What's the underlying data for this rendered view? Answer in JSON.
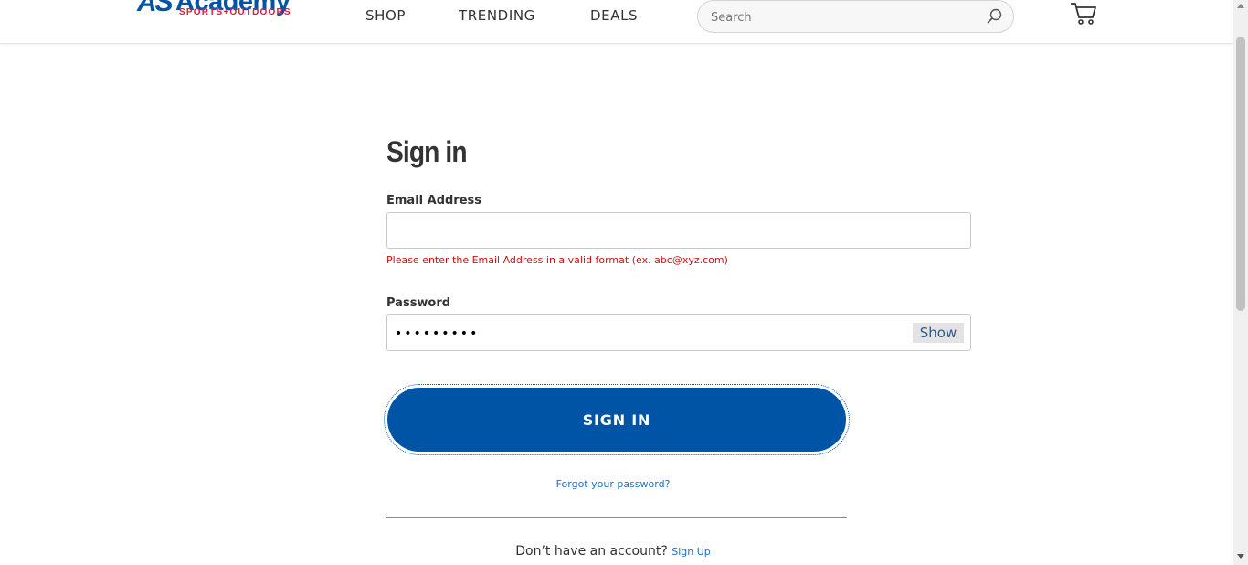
{
  "header": {
    "logo_mark": "AS",
    "logo_word": "Academy",
    "logo_sub": "SPORTS+OUTDOORS",
    "nav": [
      "SHOP",
      "TRENDING",
      "DEALS"
    ],
    "search_placeholder": "Search"
  },
  "form": {
    "title": "Sign in",
    "email_label": "Email Address",
    "email_value": "",
    "email_error": "Please enter the Email Address in a valid format (ex. abc@xyz.com)",
    "password_label": "Password",
    "password_value": "abcdefghi",
    "show_label": "Show",
    "submit_label": "SIGN IN",
    "forgot_link": "Forgot your password?",
    "signup_prompt": "Don’t have an account?",
    "signup_link": "Sign Up"
  },
  "colors": {
    "brand_blue": "#0054a6",
    "brand_red": "#e31837",
    "error_red": "#d20f0f",
    "link_blue": "#1a6fc9"
  }
}
